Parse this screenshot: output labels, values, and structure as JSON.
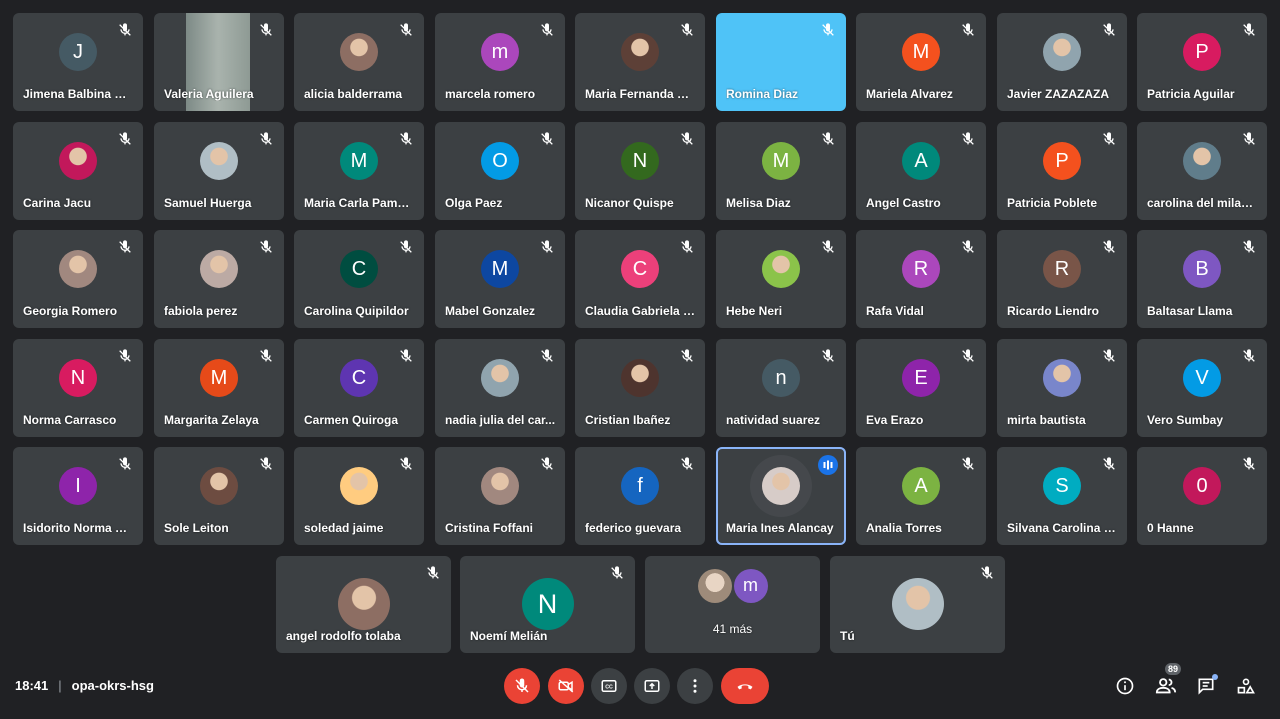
{
  "meeting": {
    "time": "18:41",
    "separator": "|",
    "code": "opa-okrs-hsg"
  },
  "participants": [
    {
      "name": "Jimena Balbina Ma...",
      "initial": "J",
      "color": "#455a64",
      "photo": false
    },
    {
      "name": "Valeria Aguilera",
      "initial": "",
      "color": "#9e9e9e",
      "photo": "video"
    },
    {
      "name": "alicia balderrama",
      "initial": "",
      "color": "#8d6e63",
      "photo": true
    },
    {
      "name": "marcela romero",
      "initial": "m",
      "color": "#ab47bc",
      "photo": false
    },
    {
      "name": "Maria Fernanda Pa...",
      "initial": "",
      "color": "#5d4037",
      "photo": true
    },
    {
      "name": "Romina Diaz",
      "initial": "",
      "color": "#4fc3f7",
      "photo": "blue"
    },
    {
      "name": "Mariela Alvarez",
      "initial": "M",
      "color": "#f4511e",
      "photo": false
    },
    {
      "name": "Javier ZAZAZAZA",
      "initial": "",
      "color": "#90a4ae",
      "photo": true
    },
    {
      "name": "Patricia Aguilar",
      "initial": "P",
      "color": "#d81b60",
      "photo": false
    },
    {
      "name": "Carina Jacu",
      "initial": "",
      "color": "#c2185b",
      "photo": true
    },
    {
      "name": "Samuel Huerga",
      "initial": "",
      "color": "#b0bec5",
      "photo": true
    },
    {
      "name": "Maria Carla Pamel...",
      "initial": "M",
      "color": "#00897b",
      "photo": false
    },
    {
      "name": "Olga Paez",
      "initial": "O",
      "color": "#039be5",
      "photo": false
    },
    {
      "name": "Nicanor Quispe",
      "initial": "N",
      "color": "#33691e",
      "photo": false
    },
    {
      "name": "Melisa Diaz",
      "initial": "M",
      "color": "#7cb342",
      "photo": false
    },
    {
      "name": "Angel Castro",
      "initial": "A",
      "color": "#00897b",
      "photo": false
    },
    {
      "name": "Patricia Poblete",
      "initial": "P",
      "color": "#f4511e",
      "photo": false
    },
    {
      "name": "carolina del milagr...",
      "initial": "",
      "color": "#607d8b",
      "photo": true
    },
    {
      "name": "Georgia Romero",
      "initial": "",
      "color": "#a1887f",
      "photo": true
    },
    {
      "name": "fabiola perez",
      "initial": "",
      "color": "#bcaaa4",
      "photo": true
    },
    {
      "name": "Carolina Quipildor",
      "initial": "C",
      "color": "#004d40",
      "photo": false
    },
    {
      "name": "Mabel Gonzalez",
      "initial": "M",
      "color": "#0d47a1",
      "photo": false
    },
    {
      "name": "Claudia Gabriela T...",
      "initial": "C",
      "color": "#ec407a",
      "photo": false
    },
    {
      "name": "Hebe Neri",
      "initial": "",
      "color": "#8bc34a",
      "photo": true
    },
    {
      "name": "Rafa Vidal",
      "initial": "R",
      "color": "#ab47bc",
      "photo": false
    },
    {
      "name": "Ricardo Liendro",
      "initial": "R",
      "color": "#795548",
      "photo": false
    },
    {
      "name": "Baltasar Llama",
      "initial": "B",
      "color": "#7e57c2",
      "photo": false
    },
    {
      "name": "Norma Carrasco",
      "initial": "N",
      "color": "#d81b60",
      "photo": false
    },
    {
      "name": "Margarita Zelaya",
      "initial": "M",
      "color": "#e64a19",
      "photo": false
    },
    {
      "name": "Carmen Quiroga",
      "initial": "C",
      "color": "#5e35b1",
      "photo": false
    },
    {
      "name": "nadia julia del car...",
      "initial": "",
      "color": "#90a4ae",
      "photo": true
    },
    {
      "name": "Cristian Ibañez",
      "initial": "",
      "color": "#4e342e",
      "photo": true
    },
    {
      "name": "natividad suarez",
      "initial": "n",
      "color": "#455a64",
      "photo": false
    },
    {
      "name": "Eva Erazo",
      "initial": "E",
      "color": "#8e24aa",
      "photo": false
    },
    {
      "name": "mirta bautista",
      "initial": "",
      "color": "#7986cb",
      "photo": true
    },
    {
      "name": "Vero Sumbay",
      "initial": "V",
      "color": "#039be5",
      "photo": false
    },
    {
      "name": "Isidorito Norma Be...",
      "initial": "I",
      "color": "#8e24aa",
      "photo": false
    },
    {
      "name": "Sole Leiton",
      "initial": "",
      "color": "#6d4c41",
      "photo": true
    },
    {
      "name": "soledad jaime",
      "initial": "",
      "color": "#ffcc80",
      "photo": true
    },
    {
      "name": "Cristina Foffani",
      "initial": "",
      "color": "#a1887f",
      "photo": true
    },
    {
      "name": "federico guevara",
      "initial": "f",
      "color": "#1565c0",
      "photo": false
    },
    {
      "name": "Maria Ines Alancay",
      "initial": "",
      "color": "#d7ccc8",
      "photo": true,
      "speaking": true
    },
    {
      "name": "Analia Torres",
      "initial": "A",
      "color": "#7cb342",
      "photo": false
    },
    {
      "name": "Silvana Carolina C...",
      "initial": "S",
      "color": "#00acc1",
      "photo": false
    },
    {
      "name": "0 Hanne",
      "initial": "0",
      "color": "#c2185b",
      "photo": false
    }
  ],
  "bottom_row": [
    {
      "name": "angel rodolfo tolaba",
      "initial": "",
      "color": "#8d6e63",
      "photo": true,
      "muted": true
    },
    {
      "name": "Noemí Melián",
      "initial": "N",
      "color": "#00897b",
      "photo": false,
      "muted": true
    },
    {
      "name": "41 más",
      "initial": "m",
      "color": "#7e57c2",
      "photo": false,
      "muted": false,
      "group": true
    },
    {
      "name": "Tú",
      "initial": "",
      "color": "#b0bec5",
      "photo": true,
      "muted": true
    }
  ],
  "controls": {
    "participant_count": "89",
    "colors": {
      "danger": "#ea4335",
      "control": "#3c4043",
      "accent": "#8ab4f8"
    }
  }
}
